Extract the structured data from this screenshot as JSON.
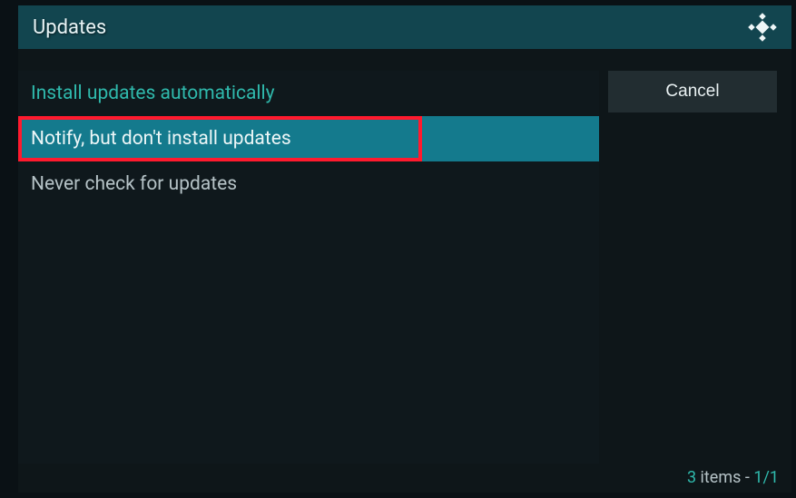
{
  "dialog": {
    "title": "Updates",
    "options": [
      {
        "label": "Install updates automatically",
        "selected_value": true,
        "focused": false
      },
      {
        "label": "Notify, but don't install updates",
        "selected_value": false,
        "focused": true
      },
      {
        "label": "Never check for updates",
        "selected_value": false,
        "focused": false
      }
    ],
    "cancel_label": "Cancel"
  },
  "footer": {
    "count": "3",
    "items_word": " items - ",
    "page": "1/1"
  },
  "annotation": {
    "highlighted_index": 1
  }
}
